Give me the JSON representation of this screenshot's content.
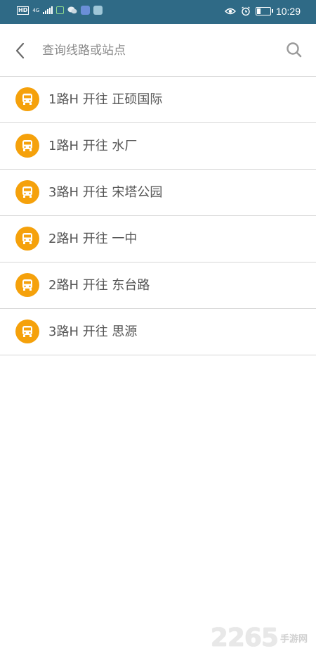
{
  "statusbar": {
    "network_badge": "HD",
    "signal_type": "4G",
    "time": "10:29",
    "icons": [
      "hd-icon",
      "signal-icon",
      "sms-icon",
      "wechat-icon",
      "music-app-icon",
      "browser-app-icon",
      "eye-icon",
      "alarm-icon",
      "battery-icon"
    ]
  },
  "search": {
    "placeholder": "查询线路或站点",
    "value": ""
  },
  "results": [
    {
      "label": "1路H 开往 正硕国际"
    },
    {
      "label": "1路H 开往 水厂"
    },
    {
      "label": "3路H 开往 宋塔公园"
    },
    {
      "label": "2路H 开往 一中"
    },
    {
      "label": "2路H 开往 东台路"
    },
    {
      "label": "3路H 开往 思源"
    }
  ],
  "watermark": {
    "number": "2265",
    "text": "手游网"
  },
  "colors": {
    "statusbar": "#2f6a86",
    "bus_badge": "#f5a10b",
    "divider": "#d6d6d6",
    "text": "#555555"
  }
}
